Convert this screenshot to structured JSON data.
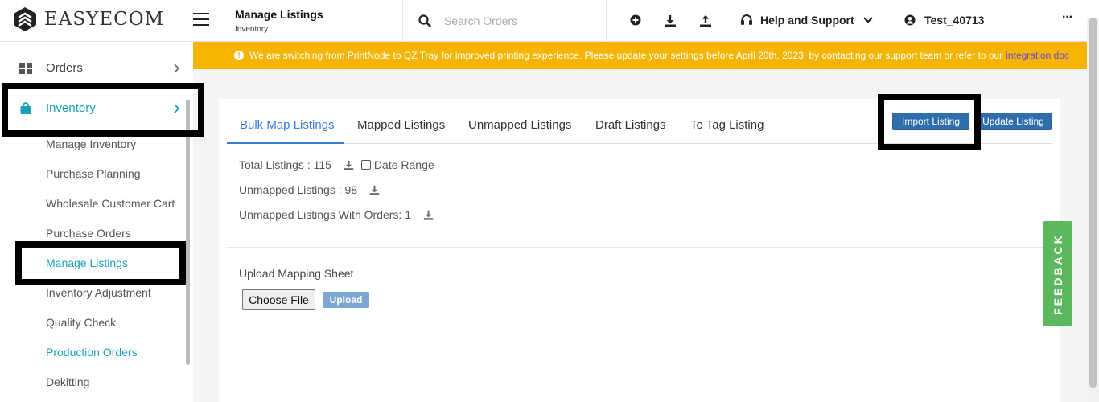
{
  "brand": {
    "name": "EASYECOM"
  },
  "header": {
    "title": "Manage Listings",
    "subtitle": "Inventory",
    "search_placeholder": "Search Orders",
    "help_label": "Help and Support",
    "user_name": "Test_40713",
    "more_label": "···"
  },
  "banner": {
    "text": "We are switching from PrintNode to QZ Tray for improved printing experience. Please update your settings before April 20th, 2023, by contacting our support team or refer to our",
    "link": "integration doc",
    "color": "#f4b400"
  },
  "sidebar": {
    "orders_label": "Orders",
    "inventory_label": "Inventory",
    "sub_items": [
      "Manage Inventory",
      "Purchase Planning",
      "Wholesale Customer Cart",
      "Purchase Orders",
      "Manage Listings",
      "Inventory Adjustment",
      "Quality Check",
      "Production Orders",
      "Dekitting"
    ],
    "accent_color": "#17a2b8"
  },
  "tabs": [
    "Bulk Map Listings",
    "Mapped Listings",
    "Unmapped Listings",
    "Draft Listings",
    "To Tag Listing"
  ],
  "actions": {
    "import": "Import Listing",
    "update": "Update Listing"
  },
  "stats": {
    "total": "Total Listings : 115",
    "date_range": "Date Range",
    "unmapped": "Unmapped Listings : 98",
    "unmapped_orders": "Unmapped Listings With Orders: 1"
  },
  "upload": {
    "label": "Upload Mapping Sheet",
    "choose_file": "Choose File",
    "upload_button": "Upload"
  },
  "feedback": {
    "label": "FEEDBACK",
    "color": "#5cb85c"
  }
}
